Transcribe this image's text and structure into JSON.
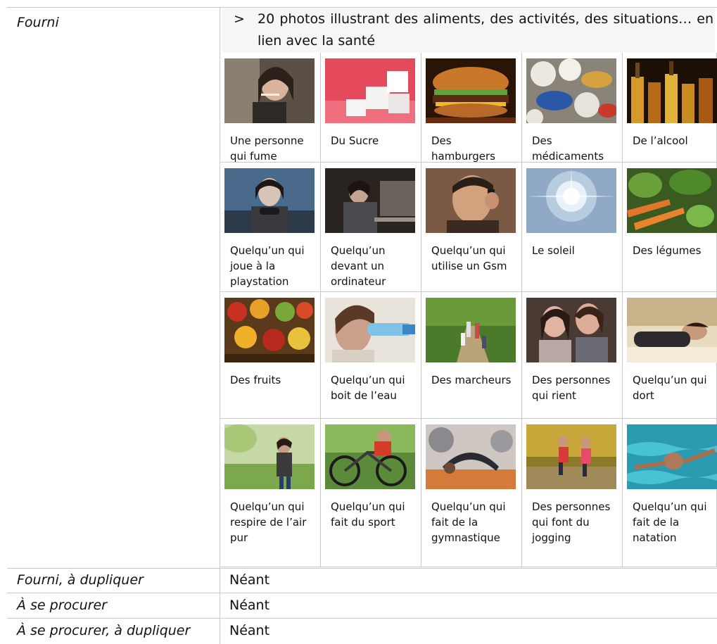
{
  "rows": [
    {
      "label": "Fourni"
    },
    {
      "label": "Fourni, à dupliquer",
      "value": "Néant"
    },
    {
      "label": "À se procurer",
      "value": "Néant"
    },
    {
      "label": "À se procurer, à dupliquer",
      "value": "Néant"
    }
  ],
  "intro": {
    "arrow": ">",
    "text": "20 photos illustrant des aliments, des activités, des situations… en lien avec la santé"
  },
  "photos": [
    {
      "caption": "Une personne qui fume",
      "icon": "person-smoking-photo"
    },
    {
      "caption": "Du Sucre",
      "icon": "sugar-cubes-photo"
    },
    {
      "caption": "Des hamburgers",
      "icon": "hamburger-photo"
    },
    {
      "caption": "Des médicaments",
      "icon": "medicine-pills-photo"
    },
    {
      "caption": "De l’alcool",
      "icon": "alcohol-bottles-photo"
    },
    {
      "caption": "Quelqu’un qui joue à la playstation",
      "icon": "gamer-photo"
    },
    {
      "caption": "Quelqu’un devant un ordinateur",
      "icon": "computer-user-photo"
    },
    {
      "caption": "Quelqu’un qui utilise un Gsm",
      "icon": "phone-call-photo"
    },
    {
      "caption": "Le soleil",
      "icon": "sun-photo"
    },
    {
      "caption": "Des légumes",
      "icon": "vegetables-photo"
    },
    {
      "caption": "Des fruits",
      "icon": "fruits-photo"
    },
    {
      "caption": "Quelqu’un qui boit de l’eau",
      "icon": "drinking-water-photo"
    },
    {
      "caption": "Des marcheurs",
      "icon": "walkers-photo"
    },
    {
      "caption": "Des personnes qui rient",
      "icon": "laughing-people-photo"
    },
    {
      "caption": "Quelqu’un qui dort",
      "icon": "sleeping-person-photo"
    },
    {
      "caption": "Quelqu’un qui respire de l’air pur",
      "icon": "fresh-air-photo"
    },
    {
      "caption": "Quelqu’un qui fait du sport",
      "icon": "cyclist-photo"
    },
    {
      "caption": "Quelqu’un qui fait de la gymnastique",
      "icon": "gymnastics-photo"
    },
    {
      "caption": "Des personnes qui font du jogging",
      "icon": "joggers-photo"
    },
    {
      "caption": "Quelqu’un qui fait de la natation",
      "icon": "swimmer-photo"
    }
  ]
}
